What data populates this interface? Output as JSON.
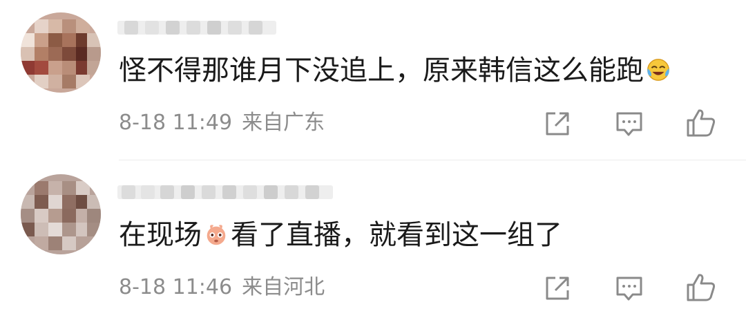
{
  "comments": [
    {
      "username": "",
      "text_before": "怪不得那谁月下没追上，原来韩信这么能跑",
      "emoji_inline": "",
      "text_after": "",
      "emoji_end": "laughing-tears-emoji",
      "time": "8-18 11:49",
      "location": "来自广东",
      "share_icon": "share-icon",
      "reply_icon": "comment-icon",
      "like_icon": "thumbs-up-icon"
    },
    {
      "username": "",
      "text_before": "在现场",
      "emoji_inline": "cute-face-emoji",
      "text_after": "看了直播，就看到这一组了",
      "emoji_end": "",
      "time": "8-18 11:46",
      "location": "来自河北",
      "share_icon": "share-icon",
      "reply_icon": "comment-icon",
      "like_icon": "thumbs-up-icon"
    }
  ],
  "colors": {
    "text": "#1a1a1a",
    "meta": "#8c8c8c",
    "icon": "#8a8a8a",
    "divider": "#ececec"
  }
}
